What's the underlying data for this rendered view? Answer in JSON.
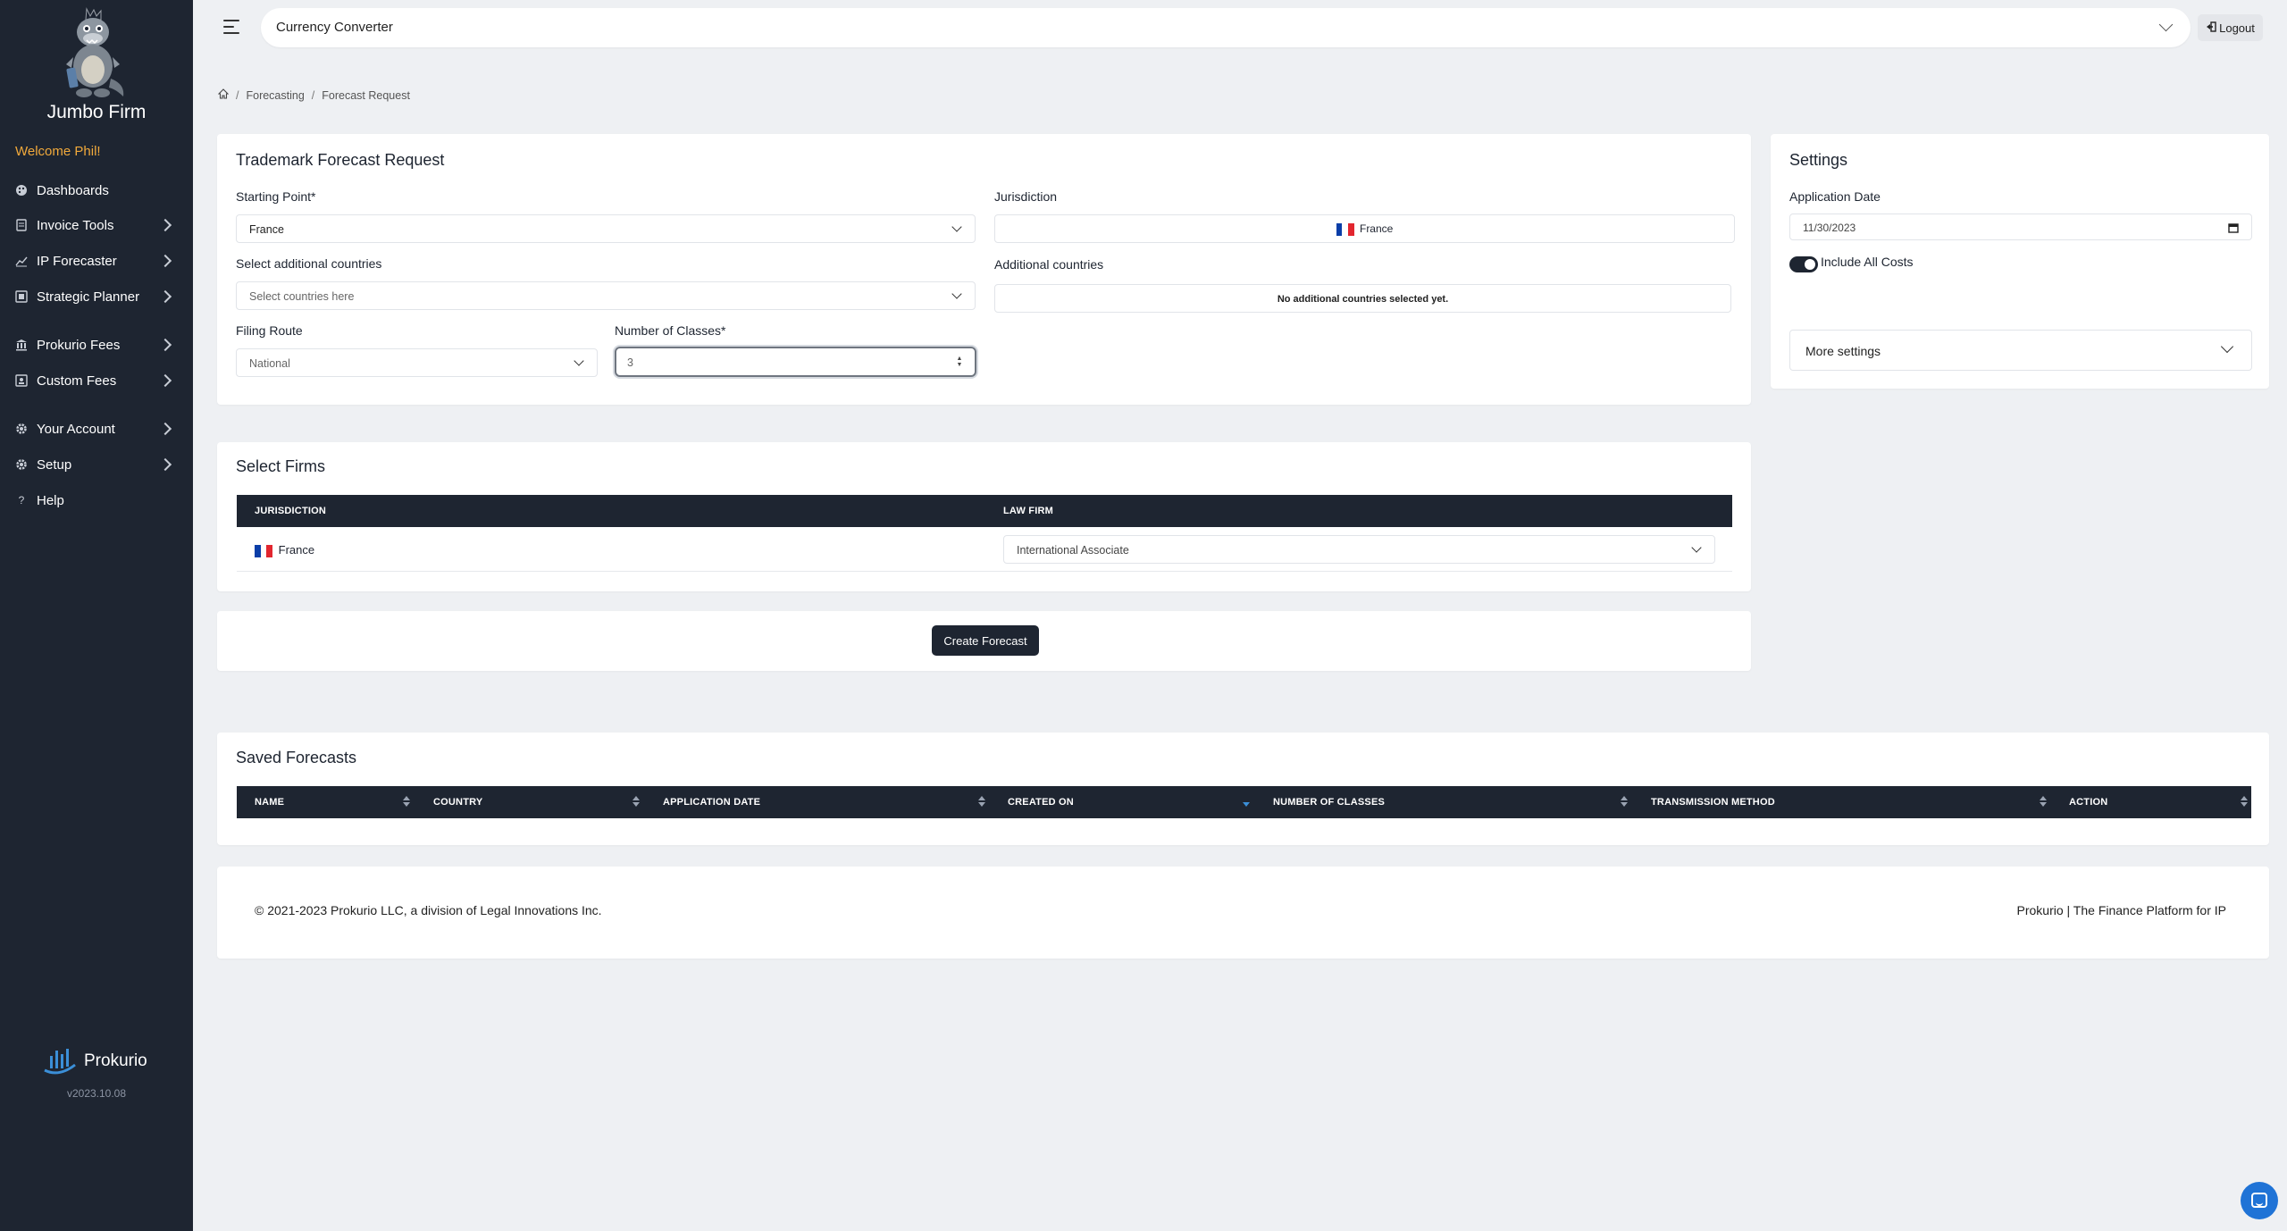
{
  "sidebar": {
    "brand": "Jumbo Firm",
    "welcome": "Welcome Phil!",
    "items": [
      {
        "label": "Dashboards",
        "icon": "palette-icon",
        "has_chevron": false
      },
      {
        "label": "Invoice Tools",
        "icon": "document-icon",
        "has_chevron": true
      },
      {
        "label": "IP Forecaster",
        "icon": "chart-icon",
        "has_chevron": true
      },
      {
        "label": "Strategic Planner",
        "icon": "planner-icon",
        "has_chevron": true
      },
      {
        "label": "Prokurio Fees",
        "icon": "bank-icon",
        "has_chevron": true
      },
      {
        "label": "Custom Fees",
        "icon": "invoice-icon",
        "has_chevron": true
      },
      {
        "label": "Your Account",
        "icon": "gear-icon",
        "has_chevron": true
      },
      {
        "label": "Setup",
        "icon": "gear-icon",
        "has_chevron": true
      },
      {
        "label": "Help",
        "icon": "question-icon",
        "has_chevron": false
      }
    ],
    "product_name": "Prokurio",
    "version": "v2023.10.08"
  },
  "topbar": {
    "title": "Currency Converter",
    "logout_label": "Logout"
  },
  "breadcrumb": {
    "items": [
      "Forecasting",
      "Forecast Request"
    ]
  },
  "forecast_request": {
    "title": "Trademark Forecast Request",
    "starting_point_label": "Starting Point*",
    "starting_point_value": "France",
    "jurisdiction_label": "Jurisdiction",
    "jurisdiction_value": "France",
    "additional_countries_select_label": "Select additional countries",
    "additional_countries_placeholder": "Select countries here",
    "additional_countries_label": "Additional countries",
    "additional_countries_empty": "No additional countries selected yet.",
    "filing_route_label": "Filing Route",
    "filing_route_value": "National",
    "number_of_classes_label": "Number of Classes*",
    "number_of_classes_value": "3"
  },
  "settings": {
    "title": "Settings",
    "application_date_label": "Application Date",
    "application_date_value": "11/30/2023",
    "include_all_costs_label": "Include All Costs",
    "include_all_costs_on": true,
    "more_settings_label": "More settings"
  },
  "select_firms": {
    "title": "Select Firms",
    "columns": [
      "JURISDICTION",
      "LAW FIRM"
    ],
    "rows": [
      {
        "jurisdiction": "France",
        "law_firm": "International Associate"
      }
    ]
  },
  "create_forecast_label": "Create Forecast",
  "saved_forecasts": {
    "title": "Saved Forecasts",
    "columns": [
      "NAME",
      "COUNTRY",
      "APPLICATION DATE",
      "CREATED ON",
      "NUMBER OF CLASSES",
      "TRANSMISSION METHOD",
      "ACTION"
    ],
    "sorted_column": "CREATED ON",
    "sort_direction": "desc"
  },
  "footer": {
    "copyright": "© 2021-2023 Prokurio LLC, a division of Legal Innovations Inc.",
    "tagline": "Prokurio | The Finance Platform for IP"
  },
  "colors": {
    "sidebar_bg": "#1e2531",
    "accent_welcome": "#f1a93b",
    "page_bg": "#eef0f3",
    "chat_button": "#1f73d6",
    "france_blue": "#0a3ea8",
    "france_red": "#e2262f"
  }
}
